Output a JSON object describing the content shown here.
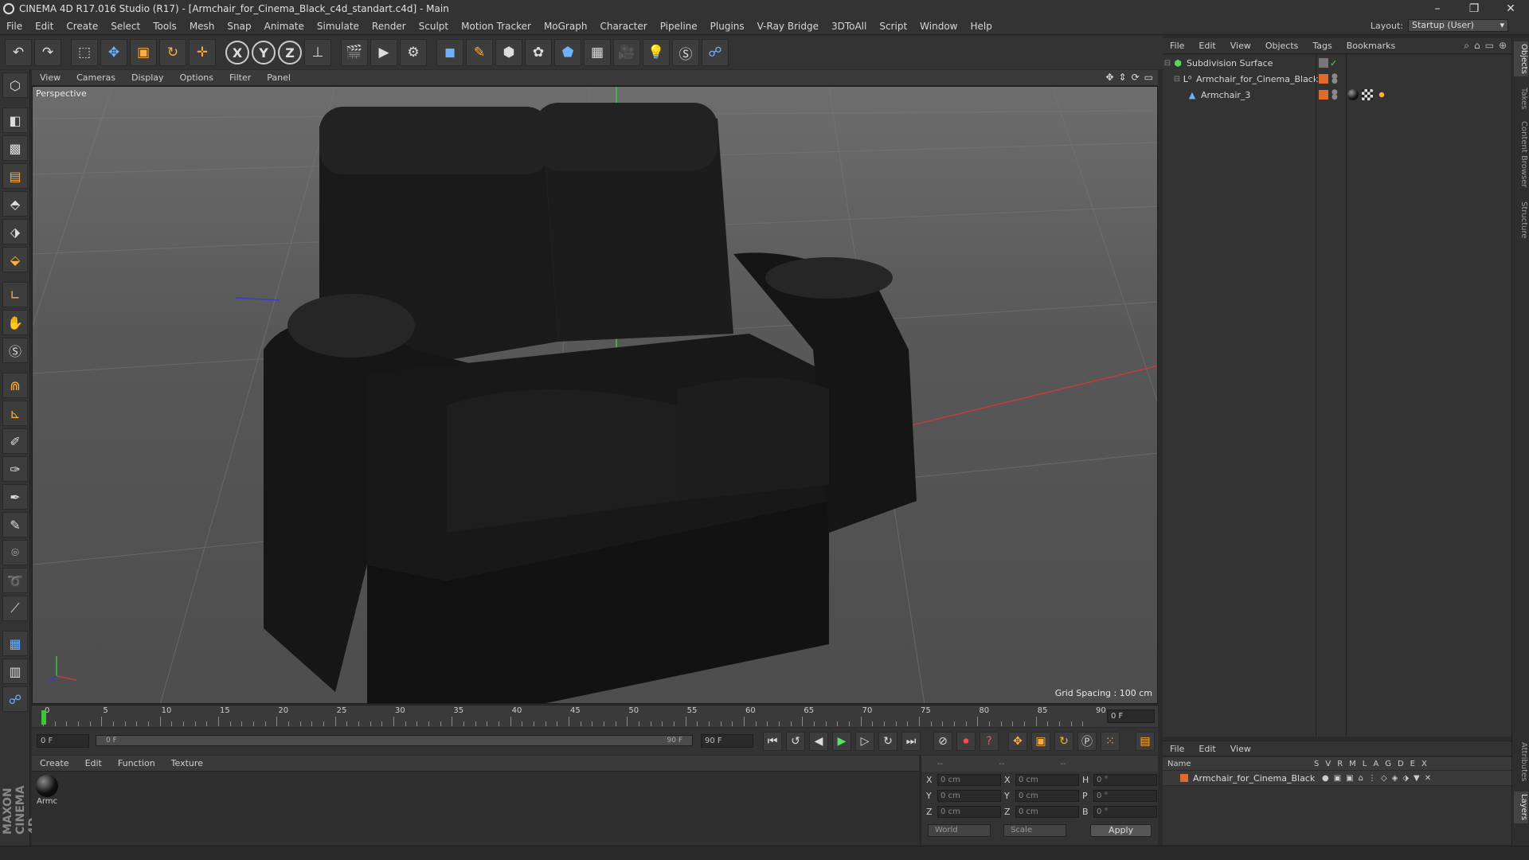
{
  "window": {
    "title": "CINEMA 4D R17.016 Studio (R17) - [Armchair_for_Cinema_Black_c4d_standart.c4d] - Main",
    "controls": [
      "–",
      "❐",
      "✕"
    ]
  },
  "menubar": {
    "items": [
      "File",
      "Edit",
      "Create",
      "Select",
      "Tools",
      "Mesh",
      "Snap",
      "Animate",
      "Simulate",
      "Render",
      "Sculpt",
      "Motion Tracker",
      "MoGraph",
      "Character",
      "Pipeline",
      "Plugins",
      "V-Ray Bridge",
      "3DToAll",
      "Script",
      "Window",
      "Help"
    ],
    "layout_label": "Layout:",
    "layout_value": "Startup (User)"
  },
  "toolbar": {
    "axis_x": "X",
    "axis_y": "Y",
    "axis_z": "Z"
  },
  "viewport": {
    "menu": [
      "View",
      "Cameras",
      "Display",
      "Options",
      "Filter",
      "Panel"
    ],
    "label": "Perspective",
    "grid_spacing": "Grid Spacing : 100 cm"
  },
  "timeline": {
    "ticks": [
      "0",
      "5",
      "10",
      "15",
      "20",
      "25",
      "30",
      "35",
      "40",
      "45",
      "50",
      "55",
      "60",
      "65",
      "70",
      "75",
      "80",
      "85",
      "90"
    ],
    "current_frame": "0 F"
  },
  "transport": {
    "start_field": "0 F",
    "range_start": "0 F",
    "range_end": "90 F",
    "end_field": "90 F"
  },
  "materials": {
    "menu": [
      "Create",
      "Edit",
      "Function",
      "Texture"
    ],
    "items": [
      {
        "label": "Armc"
      }
    ]
  },
  "coordinates": {
    "headers": [
      "--",
      "--",
      "--"
    ],
    "rows": [
      {
        "a1": "X",
        "v1": "0 cm",
        "a2": "X",
        "v2": "0 cm",
        "a3": "H",
        "v3": "0 °"
      },
      {
        "a1": "Y",
        "v1": "0 cm",
        "a2": "Y",
        "v2": "0 cm",
        "a3": "P",
        "v3": "0 °"
      },
      {
        "a1": "Z",
        "v1": "0 cm",
        "a2": "Z",
        "v2": "0 cm",
        "a3": "B",
        "v3": "0 °"
      }
    ],
    "mode1": "World",
    "mode2": "Scale",
    "apply_label": "Apply"
  },
  "object_manager": {
    "menu": [
      "File",
      "Edit",
      "View",
      "Objects",
      "Tags",
      "Bookmarks"
    ],
    "objects": [
      {
        "name": "Subdivision Surface"
      },
      {
        "name": "Armchair_for_Cinema_Black"
      },
      {
        "name": "Armchair_3"
      }
    ]
  },
  "layers": {
    "menu": [
      "File",
      "Edit",
      "View"
    ],
    "col_name": "Name",
    "cols": [
      "S",
      "V",
      "R",
      "M",
      "L",
      "A",
      "G",
      "D",
      "E",
      "X"
    ],
    "rows": [
      {
        "name": "Armchair_for_Cinema_Black"
      }
    ]
  },
  "right_tabs": [
    "Objects",
    "Takes",
    "Content Browser",
    "Structure",
    "Attributes",
    "Layers"
  ],
  "branding": "MAXON CINEMA 4D",
  "colors": {
    "accent_orange": "#e06a2a",
    "active_green": "#58d858",
    "y_axis_green": "#3cc63c",
    "x_axis_red": "#c63c3c"
  }
}
